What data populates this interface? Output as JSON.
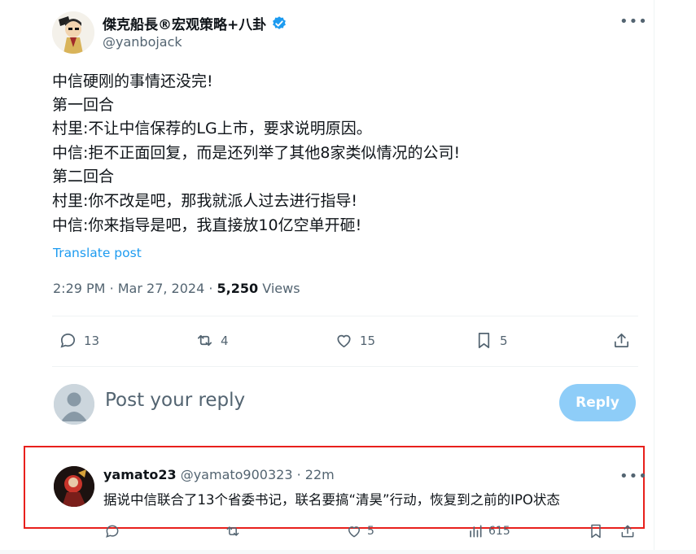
{
  "author": {
    "display_name": "傑克船長®宏观策略+八卦",
    "handle": "@yanbojack",
    "verified": true,
    "avatar_icon": "cartoon-avatar-icon"
  },
  "post": {
    "lines": [
      "中信硬刚的事情还没完!",
      "第一回合",
      "村里:不让中信保荐的LG上市，要求说明原因。",
      "中信:拒不正面回复，而是还列举了其他8家类似情况的公司!",
      "第二回合",
      "村里:你不改是吧，那我就派人过去进行指导!",
      "中信:你来指导是吧，我直接放10亿空单开砸!"
    ],
    "translate_label": "Translate post",
    "time": "2:29 PM",
    "date": "Mar 27, 2024",
    "views_count": "5,250",
    "views_label": "Views"
  },
  "actions": {
    "replies": "13",
    "reposts": "4",
    "likes": "15",
    "bookmarks": "5"
  },
  "composer": {
    "placeholder": "Post your reply",
    "button_label": "Reply"
  },
  "reply": {
    "display_name": "yamato23",
    "handle": "@yamato900323",
    "separator": "·",
    "time_ago": "22m",
    "text": "据说中信联合了13个省委书记，联名要搞“清昊”行动，恢复到之前的IPO状态",
    "likes": "5",
    "views": "615"
  },
  "colors": {
    "accent": "#1d9bf0",
    "reply_button": "#8ecdf8",
    "highlight_border": "#e8201c",
    "muted_text": "#536471"
  }
}
